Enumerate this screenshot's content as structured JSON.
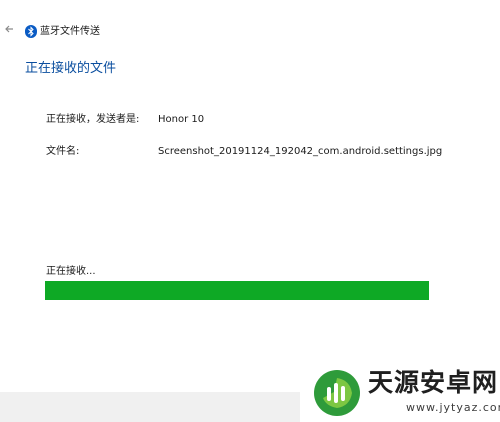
{
  "window": {
    "title": "蓝牙文件传送",
    "back_icon": "back-arrow-icon",
    "app_icon": "bluetooth-icon",
    "accent_color": "#0a4e9f"
  },
  "page": {
    "title": "正在接收的文件"
  },
  "details": {
    "sender_label": "正在接收，发送者是:",
    "sender_value": "Honor 10",
    "filename_label": "文件名:",
    "filename_value": "Screenshot_20191124_192042_com.android.settings.jpg"
  },
  "progress": {
    "status": "正在接收...",
    "fraction": 1.0,
    "color": "#0ea925"
  },
  "watermark": {
    "name": "天源安卓网",
    "url": "www.jytyaz.com"
  }
}
